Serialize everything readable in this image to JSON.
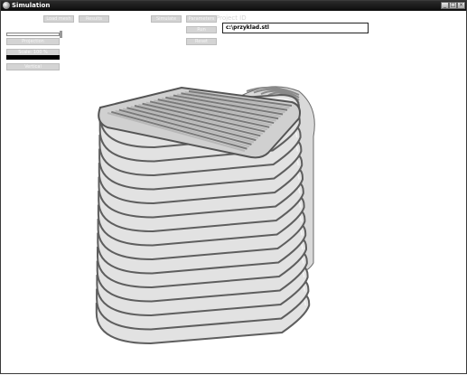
{
  "window": {
    "title": "Simulation"
  },
  "toolbar": {
    "load_label": "Load mesh",
    "results_label": "Results",
    "simulate_label": "Simulate",
    "parameters_label": "Parameters",
    "path_placeholder_label": "Project ID",
    "path_value": "c:\\przyklad.stl",
    "run_label": "Run",
    "reset_label": "Reset"
  },
  "left_panel": {
    "projection_label": "Projection",
    "scale_label": "Scale: 100 %",
    "vertical_label": "Vertical"
  }
}
